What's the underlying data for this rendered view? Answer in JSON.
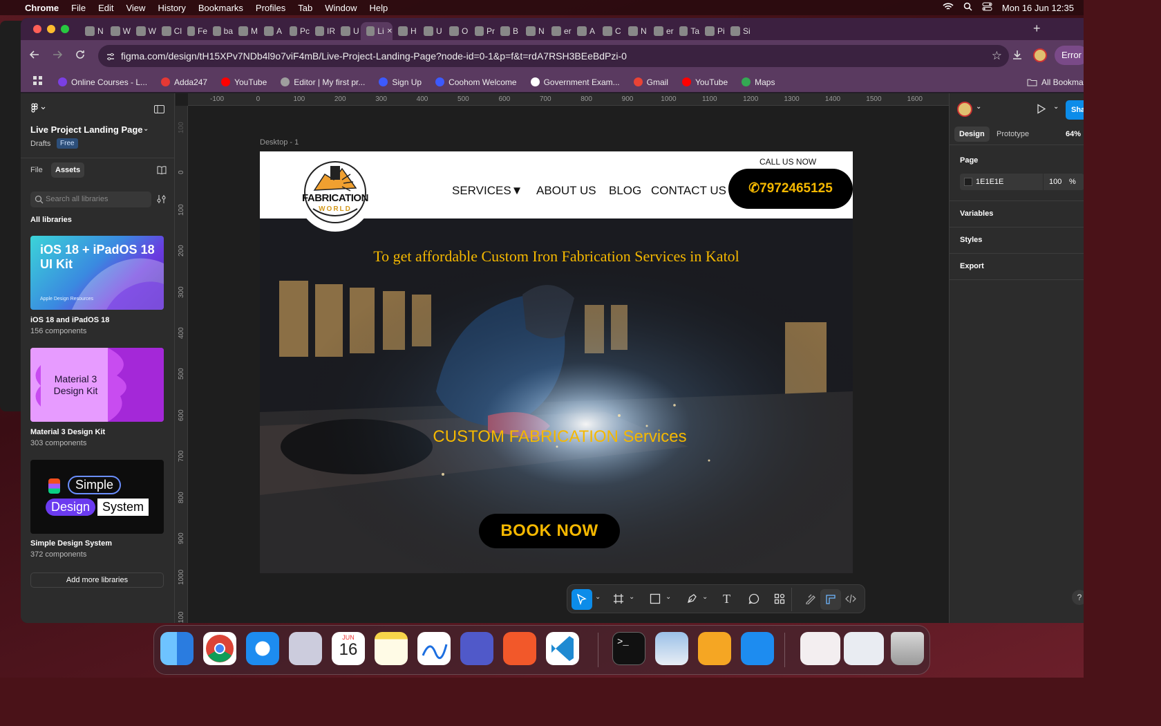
{
  "menubar": {
    "app": "Chrome",
    "items": [
      "File",
      "Edit",
      "View",
      "History",
      "Bookmarks",
      "Profiles",
      "Tab",
      "Window",
      "Help"
    ],
    "clock": "Mon 16 Jun  12:35"
  },
  "browser": {
    "tabs": [
      "N",
      "W",
      "W",
      "Cl",
      "Fe",
      "ba",
      "M",
      "A",
      "Pc",
      "IR",
      "U",
      "Li",
      "H",
      "U",
      "O",
      "Pr",
      "B",
      "N",
      "er",
      "A",
      "C",
      "N",
      "er",
      "Ta",
      "Pi",
      "Si"
    ],
    "url": "figma.com/design/tH15XPv7NDb4l9o7viF4mB/Live-Project-Landing-Page?node-id=0-1&p=f&t=rdA7RSH3BEeBdPzi-0",
    "error_label": "Error",
    "bookmarks": [
      {
        "label": "Online Courses - L...",
        "color": "#7b3fe4"
      },
      {
        "label": "Adda247",
        "color": "#e53935"
      },
      {
        "label": "YouTube",
        "color": "#ff0000"
      },
      {
        "label": "Editor | My first pr...",
        "color": "#9e9e9e"
      },
      {
        "label": "Sign Up",
        "color": "#3d5afe"
      },
      {
        "label": "Coohom Welcome",
        "color": "#3d5afe"
      },
      {
        "label": "Government Exam...",
        "color": "#ffffff"
      },
      {
        "label": "Gmail",
        "color": "#ea4335"
      },
      {
        "label": "YouTube",
        "color": "#ff0000"
      },
      {
        "label": "Maps",
        "color": "#34a853"
      }
    ],
    "all_bookmarks": "All Bookma"
  },
  "figma": {
    "file_title": "Live Project Landing Page",
    "drafts": "Drafts",
    "plan_badge": "Free",
    "tab_file": "File",
    "tab_assets": "Assets",
    "search_placeholder": "Search all libraries",
    "all_libraries": "All libraries",
    "libraries": [
      {
        "name": "iOS 18 and iPadOS 18",
        "count": "156 components",
        "thumb_title": "iOS 18 + iPadOS 18 UI Kit",
        "thumb_sub": "Apple Design Resources"
      },
      {
        "name": "Material 3 Design Kit",
        "count": "303 components",
        "thumb_title": "Material 3 Design Kit"
      },
      {
        "name": "Simple Design System",
        "count": "372 components",
        "thumb_words": [
          "Simple",
          "Design",
          "System"
        ]
      }
    ],
    "add_libraries": "Add more libraries",
    "frame_label": "Desktop - 1",
    "ruler_h": [
      "-100",
      "0",
      "100",
      "200",
      "300",
      "400",
      "500",
      "600",
      "700",
      "800",
      "900",
      "1000",
      "1100",
      "1200",
      "1300",
      "1400",
      "1500",
      "1600"
    ],
    "ruler_v": [
      "100",
      "0",
      "100",
      "200",
      "300",
      "400",
      "500",
      "600",
      "700",
      "800",
      "900",
      "1000",
      "1100"
    ],
    "right": {
      "tab_design": "Design",
      "tab_prototype": "Prototype",
      "zoom": "64%",
      "share": "Sha",
      "page_heading": "Page",
      "page_color": "1E1E1E",
      "page_opacity": "100",
      "percent": "%",
      "variables": "Variables",
      "styles": "Styles",
      "export": "Export"
    }
  },
  "site": {
    "logo_top": "FABRICATION",
    "logo_bottom": "WORLD",
    "nav": [
      "SERVICES▼",
      "ABOUT US",
      "BLOG",
      "CONTACT US"
    ],
    "call_us": "CALL US NOW",
    "phone": "✆7972465125",
    "tagline": "To get affordable Custom Iron Fabrication Services in Katol",
    "headline": "CUSTOM FABRICATION Services",
    "cta": "BOOK NOW",
    "accent": "#f5b800"
  },
  "dock": {
    "calendar_month": "JUN",
    "calendar_day": "16"
  }
}
